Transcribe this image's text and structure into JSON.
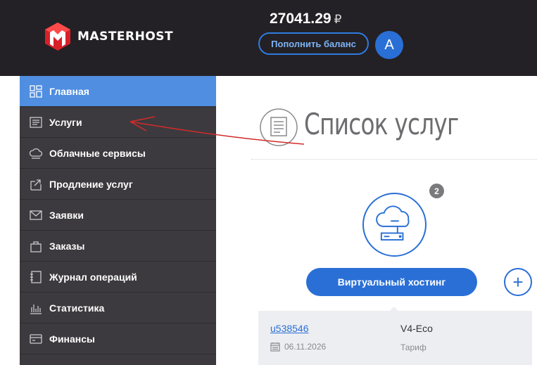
{
  "header": {
    "brand": "MASTERHOST",
    "balance": "27041.29",
    "currency": "₽",
    "topup_label": "Пополнить баланс",
    "avatar_letter": "A"
  },
  "sidebar": {
    "items": [
      {
        "label": "Главная",
        "icon": "dashboard-icon",
        "active": true
      },
      {
        "label": "Услуги",
        "icon": "list-icon"
      },
      {
        "label": "Облачные сервисы",
        "icon": "cloud-icon"
      },
      {
        "label": "Продление услуг",
        "icon": "renew-icon"
      },
      {
        "label": "Заявки",
        "icon": "envelope-icon"
      },
      {
        "label": "Заказы",
        "icon": "bag-icon"
      },
      {
        "label": "Журнал операций",
        "icon": "journal-icon"
      },
      {
        "label": "Статистика",
        "icon": "chart-icon"
      },
      {
        "label": "Финансы",
        "icon": "card-icon"
      }
    ]
  },
  "main": {
    "title": "Список услуг",
    "service": {
      "count": "2",
      "button_label": "Виртуальный хостинг",
      "add_label": "+"
    },
    "card": {
      "account": "u538546",
      "date": "06.11.2026",
      "plan": "V4-Eco",
      "plan_label": "Тариф"
    }
  },
  "colors": {
    "header_bg": "#232125",
    "sidebar_bg": "#3c3a3e",
    "active_item": "#4f8ee0",
    "accent": "#2a6fd6",
    "annotation": "#d42a2a"
  }
}
